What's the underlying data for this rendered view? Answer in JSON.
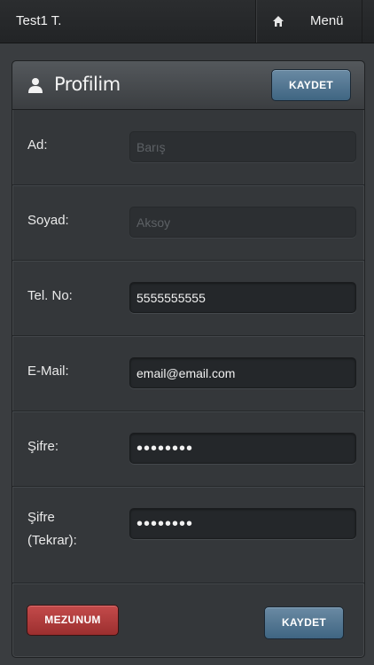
{
  "topbar": {
    "user_name": "Test1 T.",
    "home_icon": "home-icon",
    "menu_label": "Menü"
  },
  "profile": {
    "title": "Profilim",
    "title_icon": "user-icon",
    "save_label": "KAYDET",
    "fields": {
      "first_name": {
        "label": "Ad:",
        "placeholder": "Barış"
      },
      "last_name": {
        "label": "Soyad:",
        "placeholder": "Aksoy"
      },
      "phone": {
        "label": "Tel. No:",
        "value": "5555555555"
      },
      "email": {
        "label": "E-Mail:",
        "value": "email@email.com"
      },
      "password": {
        "label": "Şifre:",
        "value": "••••••••"
      },
      "password_repeat": {
        "label_line1": "Şifre",
        "label_line2": "(Tekrar):",
        "value": "••••••••"
      }
    },
    "graduate_label": "MEZUNUM",
    "save_bottom_label": "KAYDET"
  },
  "colors": {
    "accent_blue": "#4f7592",
    "danger_red": "#b03d3d",
    "background": "#3a3d40"
  }
}
